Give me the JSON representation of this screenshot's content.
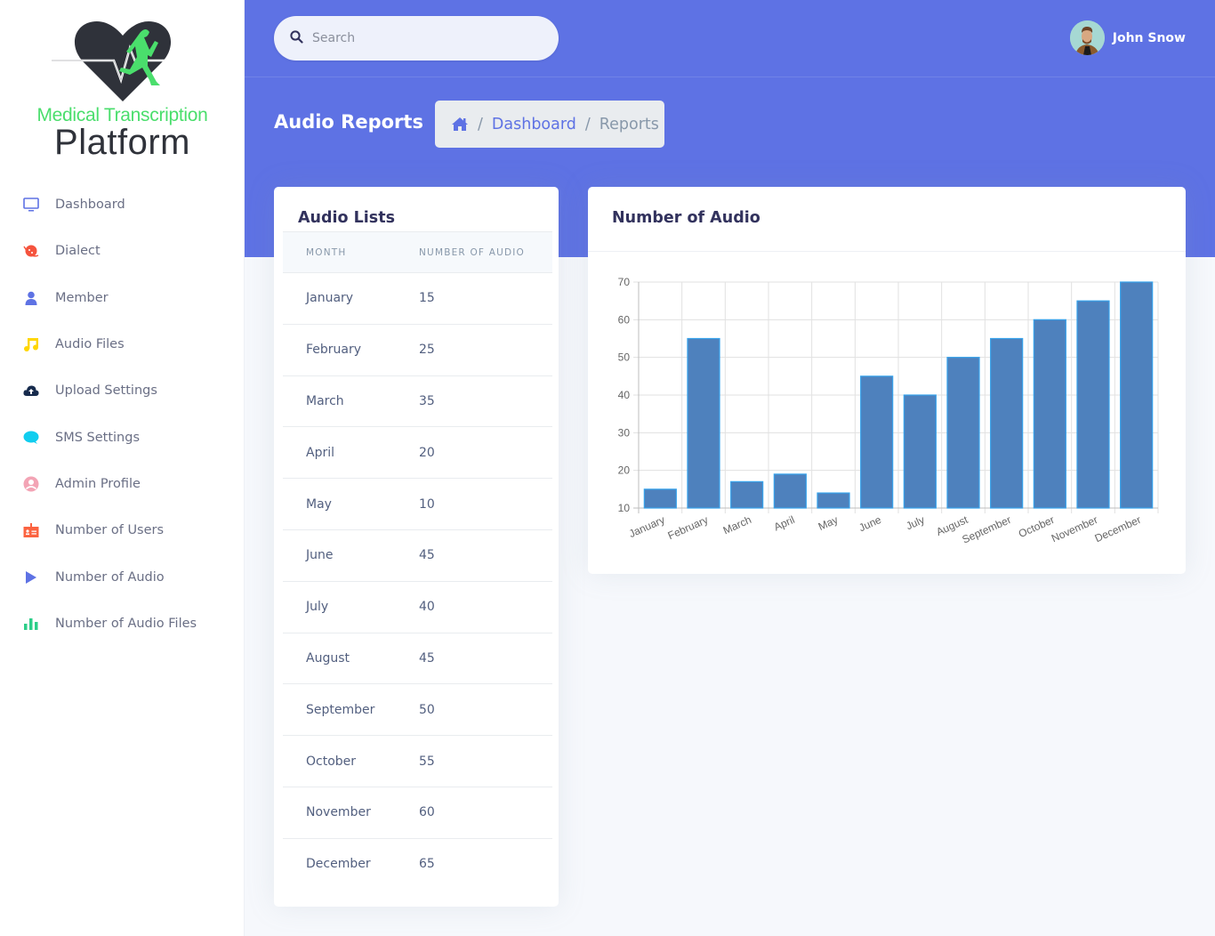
{
  "app": {
    "logo_line1": "Medical Transcription",
    "logo_line2": "Platform"
  },
  "sidebar": {
    "items": [
      {
        "label": "Dashboard",
        "icon": "monitor-icon",
        "color": "#5e72e4"
      },
      {
        "label": "Dialect",
        "icon": "planet-icon",
        "color": "#f5533d"
      },
      {
        "label": "Member",
        "icon": "user-icon",
        "color": "#5e72e4"
      },
      {
        "label": "Audio Files",
        "icon": "music-note-icon",
        "color": "#ffd600"
      },
      {
        "label": "Upload Settings",
        "icon": "cloud-upload-icon",
        "color": "#172b4d"
      },
      {
        "label": "SMS Settings",
        "icon": "chat-bubble-icon",
        "color": "#11cdef"
      },
      {
        "label": "Admin Profile",
        "icon": "user-circle-icon",
        "color": "#f3a4b5"
      },
      {
        "label": "Number of Users",
        "icon": "badge-icon",
        "color": "#fb6340"
      },
      {
        "label": "Number of Audio",
        "icon": "play-icon",
        "color": "#5e72e4"
      },
      {
        "label": "Number of Audio Files",
        "icon": "bar-chart-icon",
        "color": "#2dce89"
      }
    ]
  },
  "header": {
    "search_placeholder": "Search",
    "user_name": "John Snow",
    "page_title": "Audio Reports",
    "breadcrumb": {
      "home_icon": "home-icon",
      "separator": "/",
      "items": [
        "Dashboard",
        "Reports"
      ]
    }
  },
  "colors": {
    "primary": "#5e72e4",
    "bar_fill": "#4e81bd",
    "bar_border": "#36a2eb"
  },
  "audio_list": {
    "title": "Audio Lists",
    "columns": [
      "Month",
      "Number of Audio"
    ],
    "rows": [
      {
        "month": "January",
        "count": "15"
      },
      {
        "month": "February",
        "count": "25"
      },
      {
        "month": "March",
        "count": "35"
      },
      {
        "month": "April",
        "count": "20"
      },
      {
        "month": "May",
        "count": "10"
      },
      {
        "month": "June",
        "count": "45"
      },
      {
        "month": "July",
        "count": "40"
      },
      {
        "month": "August",
        "count": "45"
      },
      {
        "month": "September",
        "count": "50"
      },
      {
        "month": "October",
        "count": "55"
      },
      {
        "month": "November",
        "count": "60"
      },
      {
        "month": "December",
        "count": "65"
      }
    ]
  },
  "chart_card": {
    "title": "Number of Audio"
  },
  "chart_data": {
    "type": "bar",
    "title": "Number of Audio",
    "xlabel": "",
    "ylabel": "",
    "categories": [
      "January",
      "February",
      "March",
      "April",
      "May",
      "June",
      "July",
      "August",
      "September",
      "October",
      "November",
      "December"
    ],
    "values": [
      15,
      55,
      17,
      19,
      14,
      45,
      40,
      50,
      55,
      60,
      65,
      70
    ],
    "ylim": [
      10,
      70
    ],
    "yticks": [
      10,
      20,
      30,
      40,
      50,
      60,
      70
    ],
    "grid": true,
    "legend": "none"
  }
}
